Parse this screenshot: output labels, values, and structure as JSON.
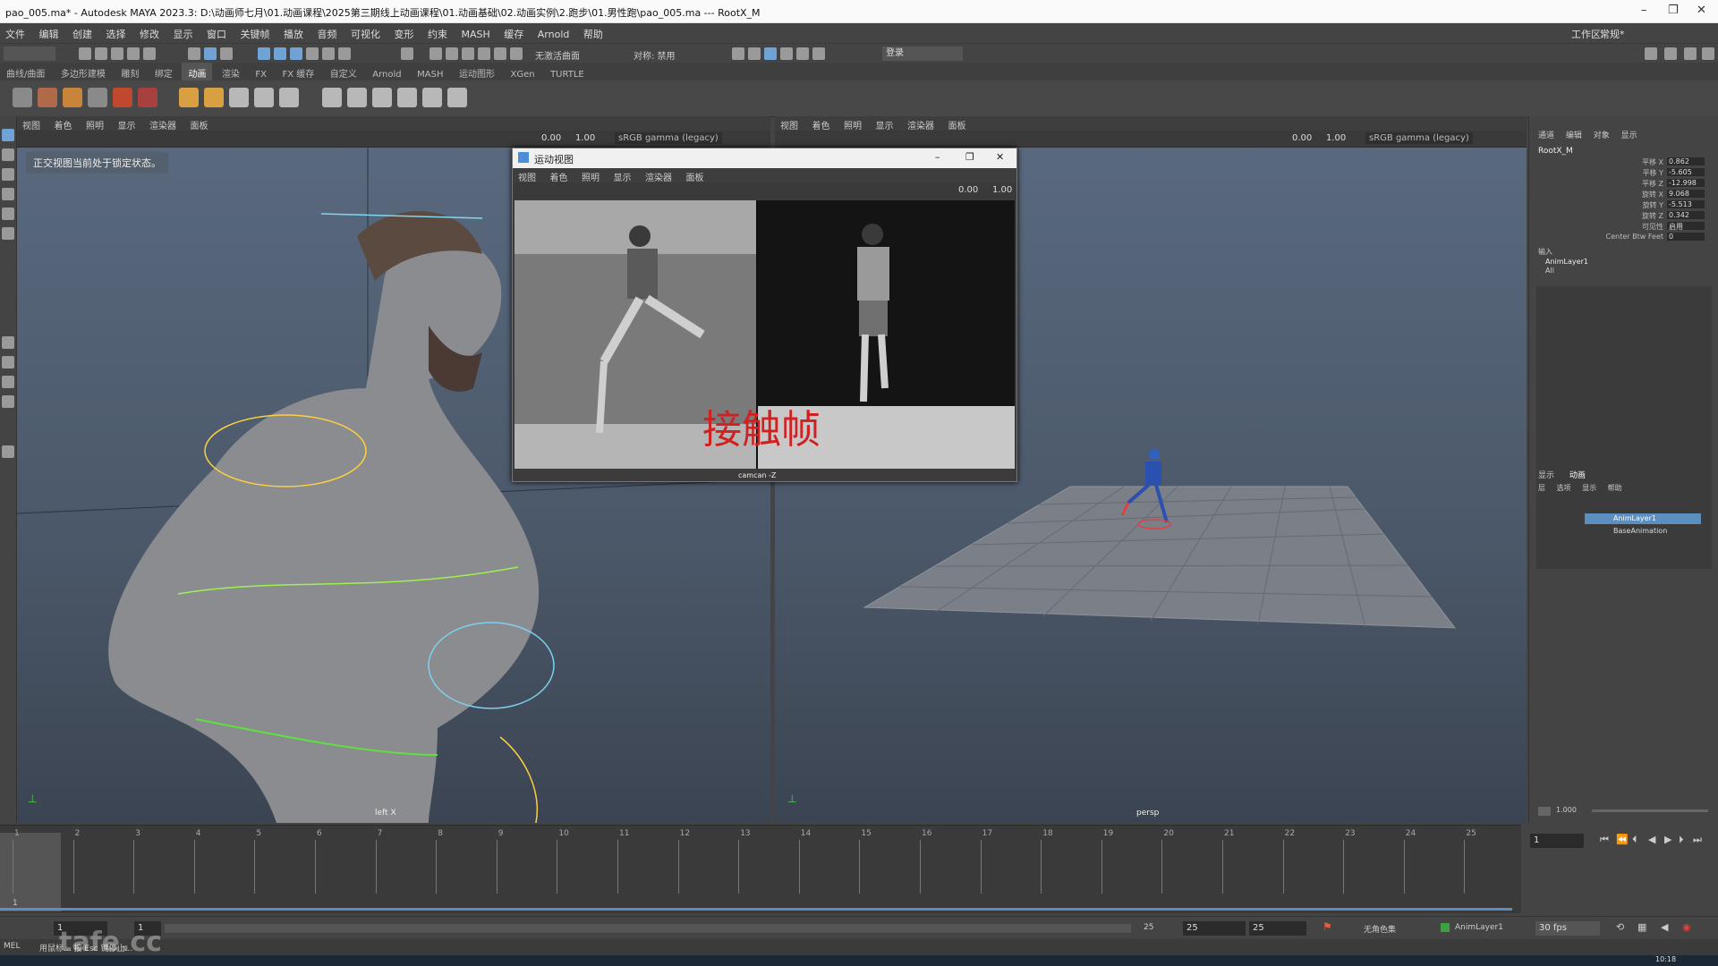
{
  "window": {
    "title": "pao_005.ma* - Autodesk MAYA 2023.3: D:\\动画师七月\\01.动画课程\\2025第三期线上动画课程\\01.动画基础\\02.动画实例\\2.跑步\\01.男性跑\\pao_005.ma  ---  RootX_M",
    "min": "–",
    "max": "❐",
    "close": "✕"
  },
  "menus": [
    "文件",
    "编辑",
    "创建",
    "选择",
    "修改",
    "显示",
    "窗口",
    "关键帧",
    "播放",
    "音频",
    "可视化",
    "变形",
    "约束",
    "MASH",
    "缓存",
    "Arnold",
    "帮助"
  ],
  "workspace": {
    "label": "工作区:",
    "value": "常规*"
  },
  "status": {
    "no_live": "无激活曲面",
    "symmetry": "对称: 禁用",
    "login": "登录"
  },
  "shelf_tabs": [
    "曲线/曲面",
    "多边形建模",
    "雕刻",
    "绑定",
    "动画",
    "渲染",
    "FX",
    "FX 缓存",
    "自定义",
    "Arnold",
    "MASH",
    "运动图形",
    "XGen",
    "TURTLE"
  ],
  "viewport_menu": [
    "视图",
    "着色",
    "照明",
    "显示",
    "渲染器",
    "面板"
  ],
  "viewport_values": {
    "exposure": "0.00",
    "gamma": "1.00",
    "color_space": "sRGB gamma (legacy)"
  },
  "left_view": {
    "lock_message": "正交视图当前处于锁定状态。",
    "camera": "left X"
  },
  "right_view": {
    "camera": "persp"
  },
  "float_window": {
    "title": "运动视图",
    "menus": [
      "视图",
      "着色",
      "照明",
      "显示",
      "渲染器",
      "面板"
    ],
    "exposure": "0.00",
    "gamma": "1.00",
    "overlay_text": "接触帧",
    "camera": "camcan -Z"
  },
  "channel_box": {
    "tabs": [
      "通道",
      "编辑",
      "对象",
      "显示"
    ],
    "object": "RootX_M",
    "attrs": [
      {
        "name": "平移 X",
        "value": "0.862"
      },
      {
        "name": "平移 Y",
        "value": "-5.605"
      },
      {
        "name": "平移 Z",
        "value": "-12.998"
      },
      {
        "name": "旋转 X",
        "value": "9.068"
      },
      {
        "name": "旋转 Y",
        "value": "-5.513"
      },
      {
        "name": "旋转 Z",
        "value": "0.342"
      },
      {
        "name": "可见性",
        "value": "启用"
      },
      {
        "name": "Center Btw Feet",
        "value": "0"
      }
    ],
    "inputs_label": "输入",
    "inputs": [
      "AnimLayer1",
      "All"
    ]
  },
  "layer_editor": {
    "tabs": [
      "显示",
      "动画"
    ],
    "menus": [
      "层",
      "选项",
      "显示",
      "帮助"
    ],
    "layers": [
      "AnimLayer1",
      "BaseAnimation"
    ],
    "weight": "1.000"
  },
  "timeline": {
    "ticks": [
      "1",
      "2",
      "3",
      "4",
      "5",
      "6",
      "7",
      "8",
      "9",
      "10",
      "11",
      "12",
      "13",
      "14",
      "15",
      "16",
      "17",
      "18",
      "19",
      "20",
      "21",
      "22",
      "23",
      "24",
      "25"
    ],
    "current_frame": "1"
  },
  "range": {
    "start": "1",
    "anim_start": "1",
    "end": "25",
    "range_end": "25",
    "anim_end": "25",
    "character_set": "无角色集",
    "anim_layer": "AnimLayer1",
    "fps": "30 fps"
  },
  "command_line": {
    "lang": "MEL",
    "hint": "用鼠标... 按 Esc 键停止...",
    "watermark": "tafe.cc"
  },
  "taskbar": {
    "clock": "10:18"
  }
}
